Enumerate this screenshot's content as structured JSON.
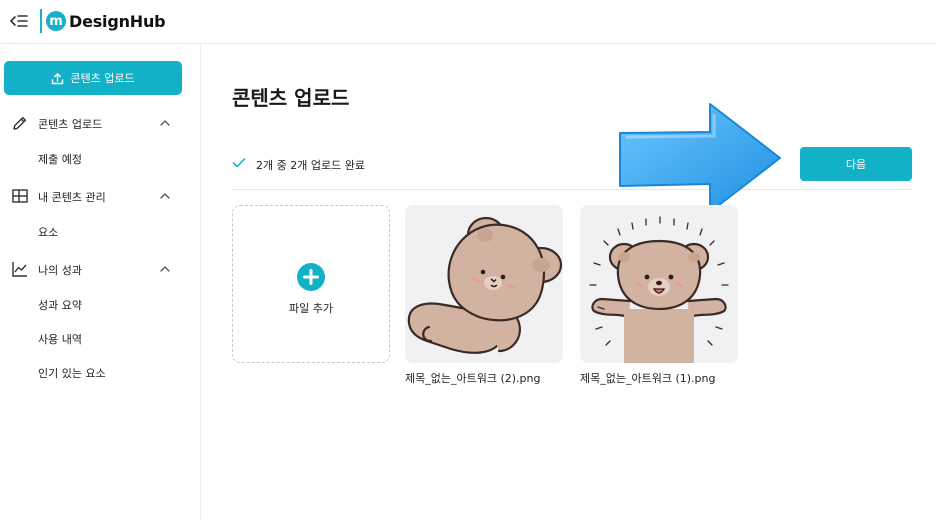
{
  "header": {
    "logo_mark": "m",
    "logo_text": "DesignHub"
  },
  "sidebar": {
    "upload_button_label": "콘텐츠 업로드",
    "groups": [
      {
        "label": "콘텐츠 업로드",
        "icon": "pencil-icon",
        "items": [
          "제출 예정"
        ]
      },
      {
        "label": "내 콘텐츠 관리",
        "icon": "layout-grid-icon",
        "items": [
          "요소"
        ]
      },
      {
        "label": "나의 성과",
        "icon": "line-chart-icon",
        "items": [
          "성과 요약",
          "사용 내역",
          "인기 있는 요소"
        ]
      }
    ]
  },
  "main": {
    "title": "콘텐츠 업로드",
    "status_text": "2개 중 2개 업로드 완료",
    "next_button_label": "다음",
    "add_file_label": "파일 추가",
    "files": [
      {
        "name": "제목_없는_아트워크 (2).png"
      },
      {
        "name": "제목_없는_아트워크 (1).png"
      }
    ]
  },
  "colors": {
    "accent": "#13b1c8",
    "arrow": "#3aa8f0"
  }
}
